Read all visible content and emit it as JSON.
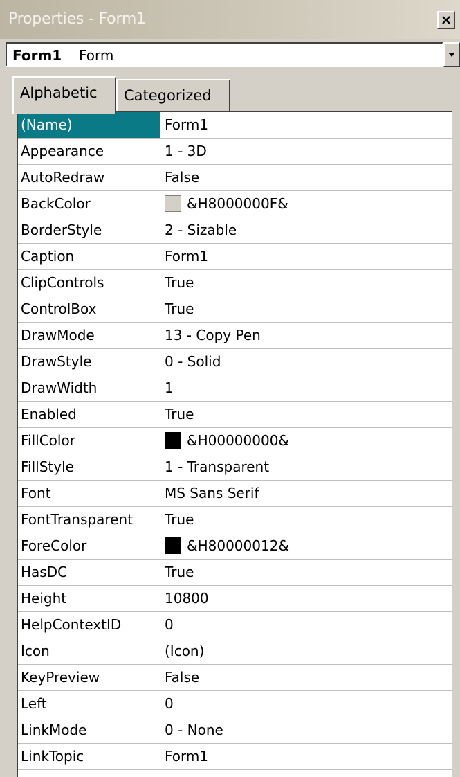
{
  "window": {
    "title": "Properties - Form1"
  },
  "object_selector": {
    "name": "Form1",
    "type": "Form"
  },
  "tabs": [
    {
      "label": "Alphabetic",
      "active": true
    },
    {
      "label": "Categorized",
      "active": false
    }
  ],
  "properties": [
    {
      "name": "(Name)",
      "value": "Form1"
    },
    {
      "name": "Appearance",
      "value": "1 - 3D"
    },
    {
      "name": "AutoRedraw",
      "value": "False"
    },
    {
      "name": "BackColor",
      "value": "&H8000000F&",
      "swatch": "#d4d0c8"
    },
    {
      "name": "BorderStyle",
      "value": "2 - Sizable"
    },
    {
      "name": "Caption",
      "value": "Form1"
    },
    {
      "name": "ClipControls",
      "value": "True"
    },
    {
      "name": "ControlBox",
      "value": "True"
    },
    {
      "name": "DrawMode",
      "value": "13 - Copy Pen"
    },
    {
      "name": "DrawStyle",
      "value": "0 - Solid"
    },
    {
      "name": "DrawWidth",
      "value": "1"
    },
    {
      "name": "Enabled",
      "value": "True"
    },
    {
      "name": "FillColor",
      "value": "&H00000000&",
      "swatch": "#000000"
    },
    {
      "name": "FillStyle",
      "value": "1 - Transparent"
    },
    {
      "name": "Font",
      "value": "MS Sans Serif"
    },
    {
      "name": "FontTransparent",
      "value": "True"
    },
    {
      "name": "ForeColor",
      "value": "&H80000012&",
      "swatch": "#000000"
    },
    {
      "name": "HasDC",
      "value": "True"
    },
    {
      "name": "Height",
      "value": "10800"
    },
    {
      "name": "HelpContextID",
      "value": "0"
    },
    {
      "name": "Icon",
      "value": "(Icon)"
    },
    {
      "name": "KeyPreview",
      "value": "False"
    },
    {
      "name": "Left",
      "value": "0"
    },
    {
      "name": "LinkMode",
      "value": "0 - None"
    },
    {
      "name": "LinkTopic",
      "value": "Form1"
    }
  ],
  "selected_property": "(Name)",
  "colors": {
    "selection": "#0a7a86",
    "face": "#d4d0c8",
    "grid_line": "#c0c0c0"
  },
  "icons": {
    "close": "close-x-icon",
    "dropdown": "dropdown-arrow-icon"
  }
}
